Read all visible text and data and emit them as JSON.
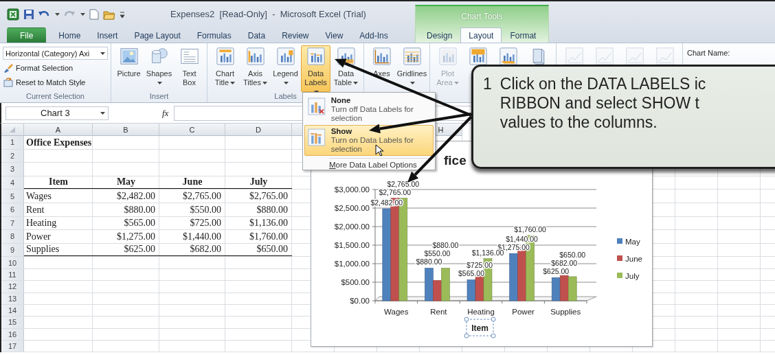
{
  "title_bar": {
    "title": "Expenses2  [Read-Only]  -  Microsoft Excel (Trial)",
    "context_label": "Chart Tools"
  },
  "tabs": [
    {
      "label": "File",
      "kind": "file",
      "selected": false
    },
    {
      "label": "Home",
      "kind": "tab",
      "selected": false
    },
    {
      "label": "Insert",
      "kind": "tab",
      "selected": false
    },
    {
      "label": "Page Layout",
      "kind": "tab",
      "selected": false
    },
    {
      "label": "Formulas",
      "kind": "tab",
      "selected": false
    },
    {
      "label": "Data",
      "kind": "tab",
      "selected": false
    },
    {
      "label": "Review",
      "kind": "tab",
      "selected": false
    },
    {
      "label": "View",
      "kind": "tab",
      "selected": false
    },
    {
      "label": "Add-Ins",
      "kind": "tab",
      "selected": false
    },
    {
      "label": "Design",
      "kind": "context",
      "selected": false
    },
    {
      "label": "Layout",
      "kind": "context",
      "selected": true
    },
    {
      "label": "Format",
      "kind": "context",
      "selected": false
    }
  ],
  "ribbon": {
    "current_selection": {
      "label": "Current Selection",
      "dropdown": "Horizontal (Category) Axi",
      "items": [
        {
          "label": "Format Selection",
          "kind": "brush"
        },
        {
          "label": "Reset to Match Style",
          "kind": "reset"
        }
      ]
    },
    "groups": [
      {
        "label": "Insert",
        "buttons": [
          {
            "label": "Picture",
            "kind": "picture",
            "caret": false,
            "selected": false,
            "disabled": false
          },
          {
            "label": "Shapes",
            "kind": "shapes",
            "caret": true,
            "selected": false,
            "disabled": false
          },
          {
            "label": "Text Box",
            "kind": "textbox",
            "caret": false,
            "selected": false,
            "disabled": false
          }
        ]
      },
      {
        "label": "Labels",
        "buttons": [
          {
            "label": "Chart Title",
            "kind": "title",
            "caret": true,
            "selected": false,
            "disabled": false
          },
          {
            "label": "Axis Titles",
            "kind": "axistitles",
            "caret": true,
            "selected": false,
            "disabled": false
          },
          {
            "label": "Legend",
            "kind": "legend",
            "caret": true,
            "selected": false,
            "disabled": false
          },
          {
            "label": "Data Labels",
            "kind": "labels",
            "caret": true,
            "selected": true,
            "disabled": false
          },
          {
            "label": "Data Table",
            "kind": "table",
            "caret": true,
            "selected": false,
            "disabled": false
          }
        ]
      },
      {
        "buttons": [
          {
            "label": "Axes",
            "kind": "axes",
            "caret": false,
            "selected": false,
            "disabled": false
          },
          {
            "label": "Gridlines",
            "kind": "gridlines",
            "caret": true,
            "selected": false,
            "disabled": false
          }
        ]
      },
      {
        "buttons": [
          {
            "label": "Plot Area",
            "kind": "plot",
            "caret": true,
            "selected": false,
            "disabled": true
          },
          {
            "kind": "wall",
            "selected": false,
            "disabled": false
          },
          {
            "kind": "floor",
            "selected": false,
            "disabled": false
          },
          {
            "kind": "cube",
            "selected": false,
            "disabled": false
          }
        ]
      },
      {
        "buttons": [
          {
            "kind": "line",
            "selected": false,
            "disabled": true
          },
          {
            "kind": "line",
            "selected": false,
            "disabled": true
          },
          {
            "kind": "line",
            "selected": false,
            "disabled": true
          },
          {
            "kind": "line",
            "selected": false,
            "disabled": true
          }
        ]
      }
    ],
    "chart_name_label": "Chart Name:"
  },
  "formula_bar": {
    "name_box": "Chart 3",
    "function_label": "fx"
  },
  "sheet": {
    "columns": [
      {
        "letter": "A"
      },
      {
        "letter": "B"
      },
      {
        "letter": "C"
      },
      {
        "letter": "D"
      },
      {
        "letter": "H"
      }
    ],
    "rows": [
      {
        "number": "1",
        "kind": "title",
        "cells": [
          "Office Expenses"
        ],
        "rule_below": false
      },
      {
        "number": "2",
        "kind": "blank"
      },
      {
        "number": "3",
        "kind": "blank"
      },
      {
        "number": "4",
        "kind": "header",
        "cells": [
          "Item",
          "May",
          "June",
          "July"
        ],
        "rule_below": true
      },
      {
        "number": "5",
        "kind": "data",
        "cells": [
          "Wages",
          "$2,482.00",
          "$2,765.00",
          "$2,765.00"
        ],
        "rule_below": false
      },
      {
        "number": "6",
        "kind": "data",
        "cells": [
          "Rent",
          "$880.00",
          "$550.00",
          "$880.00"
        ],
        "rule_below": false
      },
      {
        "number": "7",
        "kind": "data",
        "cells": [
          "Heating",
          "$565.00",
          "$725.00",
          "$1,136.00"
        ],
        "rule_below": false
      },
      {
        "number": "8",
        "kind": "data",
        "cells": [
          "Power",
          "$1,275.00",
          "$1,440.00",
          "$1,760.00"
        ],
        "rule_below": false
      },
      {
        "number": "9",
        "kind": "data",
        "cells": [
          "Supplies",
          "$625.00",
          "$682.00",
          "$650.00"
        ],
        "rule_below": true
      },
      {
        "number": "10",
        "kind": "blank"
      },
      {
        "number": "11",
        "kind": "blank"
      },
      {
        "number": "12",
        "kind": "blank"
      },
      {
        "number": "13",
        "kind": "blank"
      },
      {
        "number": "14",
        "kind": "blank"
      },
      {
        "number": "15",
        "kind": "blank"
      },
      {
        "number": "16",
        "kind": "blank"
      },
      {
        "number": "17",
        "kind": "blank"
      }
    ]
  },
  "chart": {
    "xlabel_selected": true,
    "chart_data": {
      "type": "bar",
      "title": "fice",
      "xlabel": "Item",
      "legend": "right",
      "grid": true,
      "categories": [
        "Wages",
        "Rent",
        "Heating",
        "Power",
        "Supplies"
      ],
      "series": [
        {
          "name": "May",
          "color": "#4f81bd",
          "values": [
            2482,
            880,
            565,
            1275,
            625
          ]
        },
        {
          "name": "June",
          "color": "#c0504d",
          "values": [
            2765,
            550,
            725,
            1440,
            682
          ]
        },
        {
          "name": "July",
          "color": "#9bbb59",
          "values": [
            2765,
            880,
            1136,
            1760,
            650
          ]
        }
      ],
      "ylim": [
        0,
        3000
      ],
      "yticks": [
        {
          "value": 0,
          "label": "$0.00"
        },
        {
          "value": 500,
          "label": "$500.00"
        },
        {
          "value": 1000,
          "label": "$1,000.00"
        },
        {
          "value": 1500,
          "label": "$1,500.00"
        },
        {
          "value": 2000,
          "label": "$2,000.00"
        },
        {
          "value": 2500,
          "label": "$2,500.00"
        },
        {
          "value": 3000,
          "label": "$3,000.00"
        }
      ],
      "value_labels": [
        [
          "$2,482.00",
          "$880.00",
          "$565.00",
          "$1,275.00",
          "$625.00"
        ],
        [
          "$2,765.00",
          "$550.00",
          "$725.00",
          "$1,440.00",
          "$682.00"
        ],
        [
          "$2,765.00",
          "$880.00",
          "$1,136.00",
          "$1,760.00",
          "$650.00"
        ]
      ]
    }
  },
  "data_labels_menu": {
    "items": [
      {
        "title": "None",
        "description": "Turn off Data Labels for selection",
        "kind": "none",
        "selected": false
      },
      {
        "title": "Show",
        "description": "Turn on Data Labels for selection",
        "kind": "show",
        "selected": true
      }
    ],
    "more": "More Data Label Options"
  },
  "callout": {
    "number": "1",
    "lines": [
      "Click on the DATA LABELS ic",
      "RIBBON and select SHOW t",
      "values to the columns."
    ]
  }
}
